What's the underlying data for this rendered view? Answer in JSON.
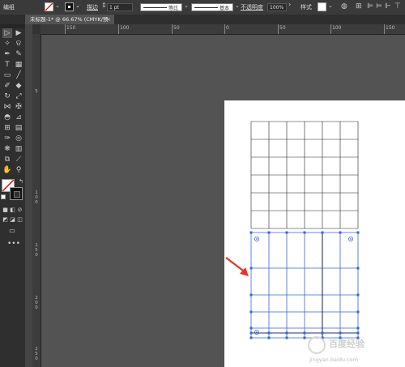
{
  "control_bar": {
    "selection_label": "编组",
    "stroke_label": "描边",
    "stroke_weight": "1 pt",
    "profile_label": "等比",
    "brush_label": "基本",
    "opacity_label": "不透明度",
    "opacity_value": "100%",
    "style_label": "样式"
  },
  "document_tab": {
    "title": "未标题-1* @ 66.67% (CMYK/预览)"
  },
  "h_ruler": [
    "150",
    "100",
    "50",
    "0",
    "50",
    "100",
    "150",
    "200"
  ],
  "v_ruler": [
    "5",
    "1 0 0",
    "1 5 0",
    "2 0 0",
    "2 5 0"
  ],
  "watermark": {
    "line1": "百度经验",
    "line2": "jingyan.baidu.com"
  },
  "colors": {
    "grid_normal": "#222222",
    "grid_selected": "#3366dd",
    "arrow": "#e8322a"
  }
}
